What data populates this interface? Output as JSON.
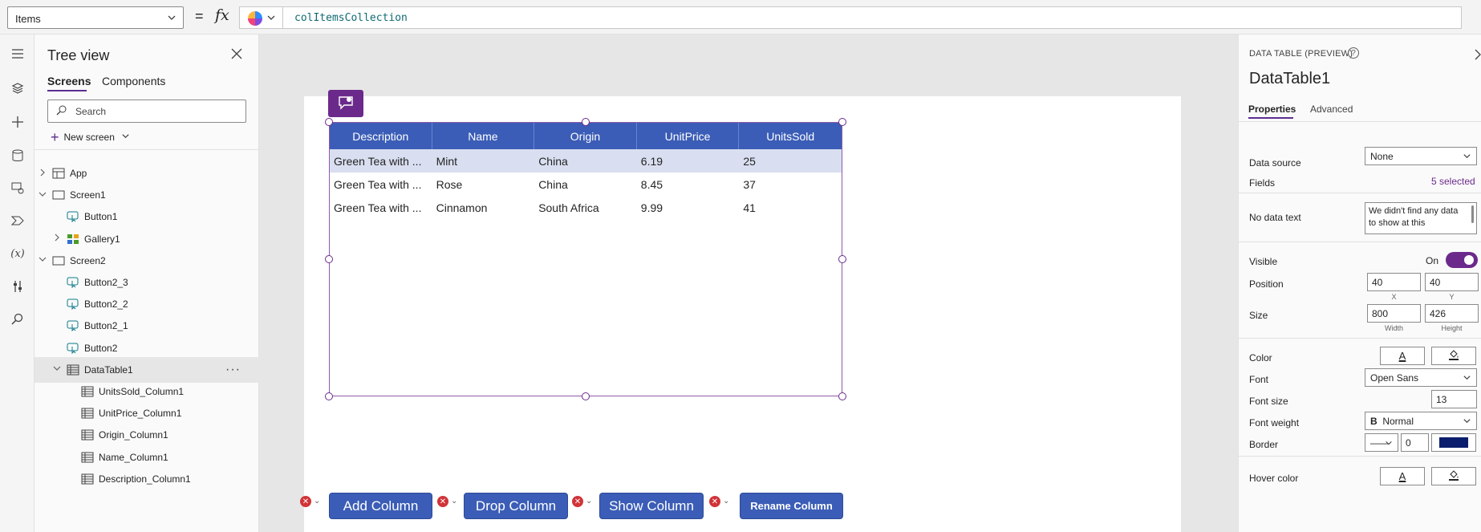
{
  "formula_bar": {
    "property": "Items",
    "equals": "=",
    "fx": "fx",
    "formula": "colItemsCollection"
  },
  "left_rail": {
    "icons": [
      "hamburger-icon",
      "tree-view-icon",
      "insert-icon",
      "data-icon",
      "media-icon",
      "power-automate-icon",
      "variables-icon",
      "advanced-tools-icon",
      "search-icon"
    ]
  },
  "tree_view": {
    "title": "Tree view",
    "tabs": [
      "Screens",
      "Components"
    ],
    "search_placeholder": "Search",
    "new_screen_label": "New screen",
    "items": [
      {
        "label": "App",
        "indent": 0,
        "expander": "›",
        "icon": "app-icon"
      },
      {
        "label": "Screen1",
        "indent": 0,
        "expander": "⌄",
        "icon": "screen-icon"
      },
      {
        "label": "Button1",
        "indent": 1,
        "expander": "",
        "icon": "button-icon"
      },
      {
        "label": "Gallery1",
        "indent": 1,
        "expander": "›",
        "icon": "gallery-icon"
      },
      {
        "label": "Screen2",
        "indent": 0,
        "expander": "⌄",
        "icon": "screen-icon"
      },
      {
        "label": "Button2_3",
        "indent": 1,
        "expander": "",
        "icon": "button-icon"
      },
      {
        "label": "Button2_2",
        "indent": 1,
        "expander": "",
        "icon": "button-icon"
      },
      {
        "label": "Button2_1",
        "indent": 1,
        "expander": "",
        "icon": "button-icon"
      },
      {
        "label": "Button2",
        "indent": 1,
        "expander": "",
        "icon": "button-icon"
      },
      {
        "label": "DataTable1",
        "indent": 1,
        "expander": "⌄",
        "icon": "table-icon",
        "selected": true
      },
      {
        "label": "UnitsSold_Column1",
        "indent": 2,
        "expander": "",
        "icon": "column-icon"
      },
      {
        "label": "UnitPrice_Column1",
        "indent": 2,
        "expander": "",
        "icon": "column-icon"
      },
      {
        "label": "Origin_Column1",
        "indent": 2,
        "expander": "",
        "icon": "column-icon"
      },
      {
        "label": "Name_Column1",
        "indent": 2,
        "expander": "",
        "icon": "column-icon"
      },
      {
        "label": "Description_Column1",
        "indent": 2,
        "expander": "",
        "icon": "column-icon"
      }
    ]
  },
  "data_table": {
    "columns": [
      "Description",
      "Name",
      "Origin",
      "UnitPrice",
      "UnitsSold"
    ],
    "rows": [
      [
        "Green Tea with ...",
        "Mint",
        "China",
        "6.19",
        "25"
      ],
      [
        "Green Tea with ...",
        "Rose",
        "China",
        "8.45",
        "37"
      ],
      [
        "Green Tea with ...",
        "Cinnamon",
        "South Africa",
        "9.99",
        "41"
      ]
    ]
  },
  "canvas_buttons": [
    {
      "label": "Add Column",
      "name": "add-column-button"
    },
    {
      "label": "Drop Column",
      "name": "drop-column-button"
    },
    {
      "label": "Show Column",
      "name": "show-column-button"
    },
    {
      "label": "Rename Column",
      "name": "rename-column-button"
    }
  ],
  "properties": {
    "kind": "DATA TABLE (PREVIEW)",
    "help": "?",
    "name": "DataTable1",
    "tabs": [
      "Properties",
      "Advanced"
    ],
    "data_source_label": "Data source",
    "data_source_value": "None",
    "fields_label": "Fields",
    "fields_value": "5 selected",
    "no_data_label": "No data text",
    "no_data_value": "We didn't find any data to show at this",
    "visible_label": "Visible",
    "visible_value": "On",
    "position_label": "Position",
    "position_x": "40",
    "position_y": "40",
    "x_label": "X",
    "y_label": "Y",
    "size_label": "Size",
    "size_width": "800",
    "size_height": "426",
    "width_label": "Width",
    "height_label": "Height",
    "color_label": "Color",
    "font_label": "Font",
    "font_value": "Open Sans",
    "font_size_label": "Font size",
    "font_size_value": "13",
    "font_weight_label": "Font weight",
    "font_weight_value": "Normal",
    "border_label": "Border",
    "border_width": "0",
    "border_color": "#0b1e6e",
    "hover_color_label": "Hover color"
  },
  "colors": {
    "accent": "#6b2a8b",
    "table_header": "#3b5db7",
    "selected_row": "#d9dff0",
    "error": "#d13438"
  }
}
